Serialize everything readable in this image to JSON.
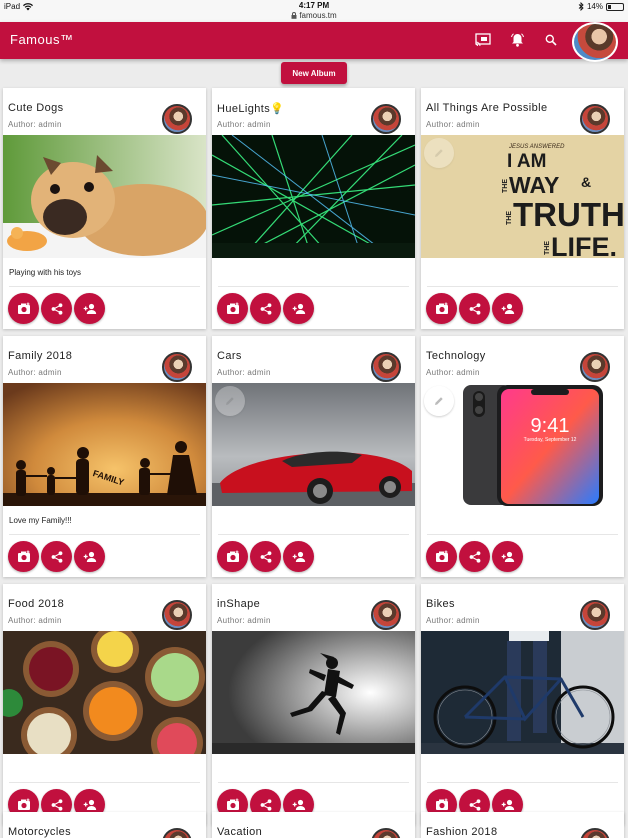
{
  "status_bar": {
    "device": "iPad",
    "time": "4:17 PM",
    "url": "famous.tm",
    "battery": "14%"
  },
  "app_bar": {
    "brand": "Famous™",
    "icons": [
      "cast-icon",
      "notification-bell-icon",
      "search-icon"
    ]
  },
  "toolbar": {
    "new_album_label": "New Album"
  },
  "colors": {
    "primary": "#c1103e",
    "background": "#ececec"
  },
  "albums": [
    {
      "title": "Cute Dogs",
      "author": "Author: admin",
      "description": "Playing with his toys",
      "image": "pug-puppy"
    },
    {
      "title": "HueLights💡",
      "author": "Author: admin",
      "description": "",
      "image": "green-laser-lights"
    },
    {
      "title": "All Things Are Possible",
      "author": "Author: admin",
      "description": "",
      "image": "way-truth-life-poster",
      "poster_text": {
        "small": "JESUS ANSWERED",
        "i_am": "I AM",
        "the": "THE",
        "way": "WAY",
        "amp": "&",
        "truth": "TRUTH",
        "life": "LIFE."
      }
    },
    {
      "title": "Family 2018",
      "author": "Author: admin",
      "description": "Love my Family!!!",
      "image": "family-silhouette-sunset",
      "overlay_text": "FAMILY"
    },
    {
      "title": "Cars",
      "author": "Author: admin",
      "description": "",
      "image": "red-supercar"
    },
    {
      "title": "Technology",
      "author": "Author: admin",
      "description": "",
      "image": "smartphone",
      "phone_time": "9:41",
      "phone_date": "Tuesday, September 12"
    },
    {
      "title": "Food 2018",
      "author": "Author: admin",
      "description": "",
      "image": "food-bowls"
    },
    {
      "title": "inShape",
      "author": "Author: admin",
      "description": "",
      "image": "runner-silhouette"
    },
    {
      "title": "Bikes",
      "author": "Author: admin",
      "description": "",
      "image": "road-bicycle"
    }
  ],
  "partial_albums": [
    {
      "title": "Motorcycles"
    },
    {
      "title": "Vacation"
    },
    {
      "title": "Fashion 2018"
    }
  ]
}
